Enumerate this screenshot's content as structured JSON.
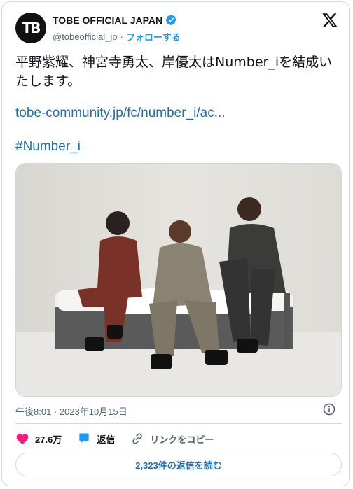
{
  "author": {
    "avatar_text": "TB",
    "name": "TOBE OFFICIAL JAPAN",
    "handle": "@tobeofficial_jp",
    "separator": "·",
    "follow_label": "フォローする",
    "verified": true
  },
  "post": {
    "text": "平野紫耀、神宮寺勇太、岸優太はNumber_iを結成いたします。",
    "link": "tobe-community.jp/fc/number_i/ac...",
    "hashtag": "#Number_i",
    "timestamp": "午後8:01 · 2023年10月15日"
  },
  "actions": {
    "likes": "27.6万",
    "reply_label": "返信",
    "copy_link_label": "リンクをコピー"
  },
  "replies_button": "2,323件の返信を読む",
  "colors": {
    "accent": "#1d9bf0",
    "like": "#f91880",
    "text": "#0f1419",
    "muted": "#536471"
  },
  "icons": [
    "x-logo-icon",
    "verified-badge-icon",
    "info-icon",
    "heart-icon",
    "reply-bubble-icon",
    "link-icon"
  ]
}
